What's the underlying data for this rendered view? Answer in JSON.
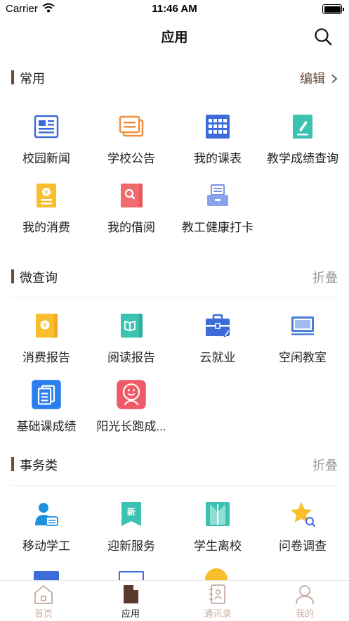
{
  "status_bar": {
    "carrier": "Carrier",
    "time": "11:46 AM"
  },
  "header": {
    "title": "应用"
  },
  "sections": [
    {
      "title": "常用",
      "action": "编辑",
      "items": [
        {
          "label": "校园新闻",
          "icon": "news-icon"
        },
        {
          "label": "学校公告",
          "icon": "announcement-icon"
        },
        {
          "label": "我的课表",
          "icon": "timetable-icon"
        },
        {
          "label": "教学成绩查询",
          "icon": "grade-query-icon"
        },
        {
          "label": "我的消费",
          "icon": "consumption-icon"
        },
        {
          "label": "我的借阅",
          "icon": "borrow-icon"
        },
        {
          "label": "教工健康打卡",
          "icon": "health-checkin-icon"
        }
      ]
    },
    {
      "title": "微查询",
      "action": "折叠",
      "items": [
        {
          "label": "消费报告",
          "icon": "consumption-report-icon"
        },
        {
          "label": "阅读报告",
          "icon": "reading-report-icon"
        },
        {
          "label": "云就业",
          "icon": "employment-icon"
        },
        {
          "label": "空闲教室",
          "icon": "free-classroom-icon"
        },
        {
          "label": "基础课成绩",
          "icon": "basic-course-grade-icon"
        },
        {
          "label": "阳光长跑成...",
          "icon": "sunshine-run-icon"
        }
      ]
    },
    {
      "title": "事务类",
      "action": "折叠",
      "items": [
        {
          "label": "移动学工",
          "icon": "mobile-student-affairs-icon"
        },
        {
          "label": "迎新服务",
          "icon": "freshman-service-icon"
        },
        {
          "label": "学生离校",
          "icon": "student-leave-icon"
        },
        {
          "label": "问卷调查",
          "icon": "survey-icon"
        }
      ]
    }
  ],
  "tabs": [
    {
      "label": "首页",
      "icon": "home-icon",
      "active": false
    },
    {
      "label": "应用",
      "icon": "apps-icon",
      "active": true
    },
    {
      "label": "通讯录",
      "icon": "contacts-icon",
      "active": false
    },
    {
      "label": "我的",
      "icon": "profile-icon",
      "active": false
    }
  ],
  "colors": {
    "accent": "#6b4a3a",
    "tab_inactive": "#c9b2a8",
    "muted": "#9a9a9a"
  }
}
